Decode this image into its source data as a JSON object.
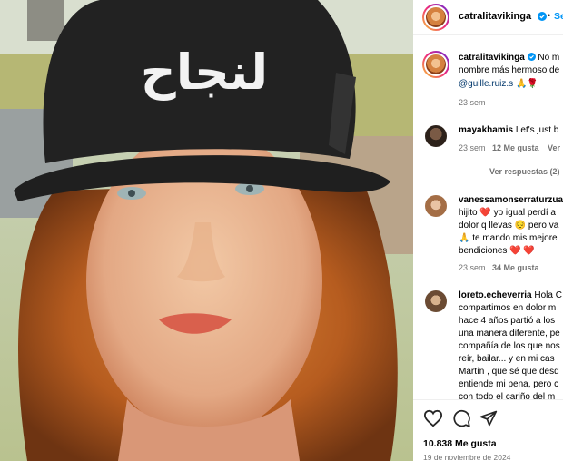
{
  "post": {
    "author": "catralitavikinga",
    "follow_label": "Seg",
    "cap_text": "لنجاح",
    "caption_line1": "No m",
    "caption_line2": "nombre más hermoso de",
    "caption_mention": "@guille.ruiz.s",
    "caption_emojis": "🙏🌹",
    "caption_time": "23 sem"
  },
  "comments": [
    {
      "user": "mayakhamis",
      "text": "Let's just b",
      "time": "23 sem",
      "likes": "12 Me gusta",
      "reply": "Ver r",
      "view_replies": "Ver respuestas (2)"
    },
    {
      "user": "vanessamonserraturzua",
      "lines": [
        "hijito ❤️ yo igual perdí a",
        "dolor q llevas 😔 pero va",
        "🙏 te mando mis mejore",
        "bendiciones ❤️ ❤️"
      ],
      "time": "23 sem",
      "likes": "34 Me gusta"
    },
    {
      "user": "loreto.echeverria",
      "first": "Hola C",
      "lines": [
        "compartimos en dolor m",
        "hace 4 años partió a los",
        "una manera diferente, pe",
        "compañía de los que nos",
        "reír, bailar... y en mi cas",
        "Martín , que sé que desd",
        "entiende mi pena, pero c",
        "con todo el cariño del m"
      ]
    }
  ],
  "footer": {
    "likes": "10.838 Me gusta",
    "date": "19 de noviembre de 2024"
  },
  "colors": {
    "link": "#00376b",
    "follow": "#0095f6",
    "muted": "#737373",
    "verified": "#0095f6",
    "heart": "#ed4956"
  },
  "icons": [
    "heart-icon",
    "comment-icon",
    "share-icon",
    "verified-icon",
    "more-icon"
  ]
}
